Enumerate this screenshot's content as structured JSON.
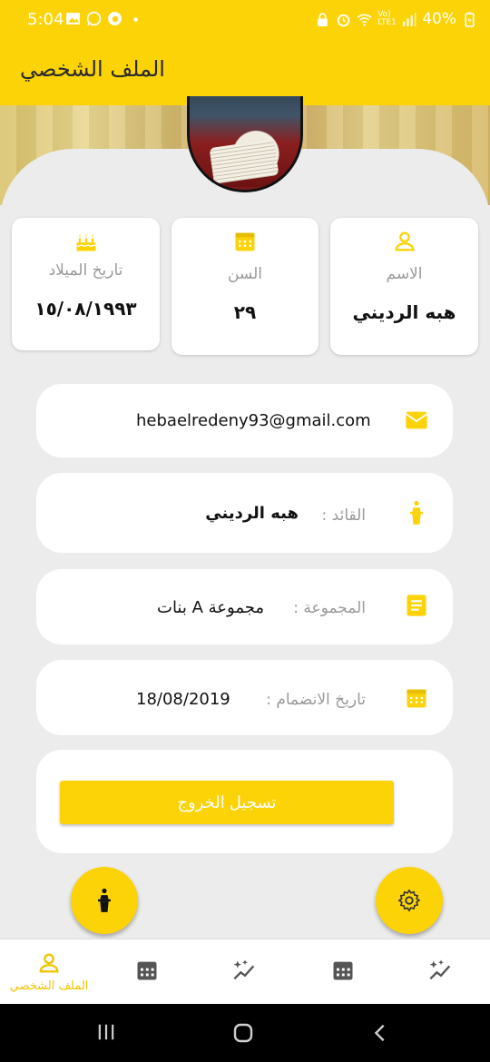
{
  "status_bar": {
    "time": "5:04",
    "battery": "40%",
    "network": "Vo) LTE1"
  },
  "app_bar": {
    "title": "الملف الشخصي"
  },
  "info_cards": [
    {
      "icon": "person-icon",
      "label": "الاسم",
      "value": "هبه الرديني"
    },
    {
      "icon": "calendar-icon",
      "label": "السن",
      "value": "٢٩"
    },
    {
      "icon": "birthday-cake-icon",
      "label": "تاريخ الميلاد",
      "value": "١٥/٠٨/١٩٩٣"
    }
  ],
  "details": {
    "email": {
      "icon": "email-icon",
      "value": "hebaelredeny93@gmail.com"
    },
    "leader": {
      "icon": "podium-icon",
      "label": "القائد :",
      "value": "هبه الرديني"
    },
    "group": {
      "icon": "notes-icon",
      "label": "المجموعة :",
      "value": "مجموعة A بنات"
    },
    "join_date": {
      "icon": "calendar-icon",
      "label": "تاريخ الانضمام :",
      "value": "18/08/2019"
    }
  },
  "logout": {
    "label": "تسجيل الخروج"
  },
  "fabs": {
    "left_icon": "podium-icon",
    "right_icon": "gear-icon"
  },
  "bottom_nav": {
    "items": [
      {
        "icon": "person-icon",
        "label": "الملف الشخصي",
        "active": true
      },
      {
        "icon": "calendar-icon"
      },
      {
        "icon": "sparkle-chart-icon"
      },
      {
        "icon": "calendar-icon"
      },
      {
        "icon": "sparkle-chart-icon"
      }
    ]
  },
  "colors": {
    "accent": "#fcd307",
    "background": "#ececec",
    "card": "#ffffff",
    "label": "#9a9a9a"
  }
}
